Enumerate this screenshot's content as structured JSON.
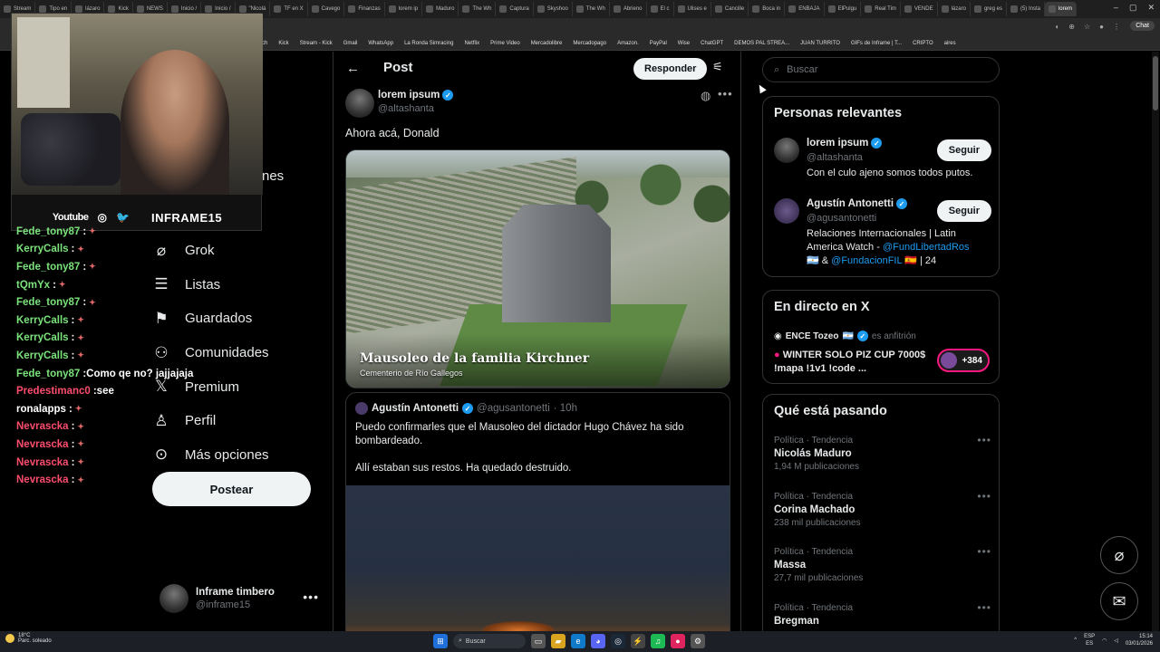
{
  "browser": {
    "tabs": [
      "Stream",
      "Tipo en",
      "lázaro",
      "Kick",
      "NEWS",
      "Inicio /",
      "Inicio /",
      "\"Nicolá",
      "TF en X",
      "Cavego",
      "Finanzas",
      "lorem ip",
      "Maduro",
      "The Wh",
      "Captura",
      "Skyshoo",
      "The Wh",
      "Abrieno",
      "El c",
      "Ulises e",
      "Cancille",
      "Boca in",
      "ENBAJA",
      "ElPulgu",
      "Real Tim",
      "VENDE",
      "lázaro",
      "greg es",
      "(5) Insta",
      "lorem"
    ],
    "bookmarks": [
      "itch",
      "Kick",
      "Stream - Kick",
      "Gmail",
      "WhatsApp",
      "La Ronda Simracing",
      "Netflix",
      "Prime Video",
      "Mercadolibre",
      "Mercadopago",
      "Amazon.",
      "PayPal",
      "Wise",
      "ChatGPT",
      "DEMOS PAL STREA...",
      "JUAN TURRITO",
      "GIFs de Inframe | T...",
      "CRIPTO",
      "aires"
    ],
    "chat_label": "Chat"
  },
  "webcam": {
    "youtube": "Youtube",
    "brand": "INFRAME15"
  },
  "chat": [
    {
      "user": "Fede_tony87",
      "color": "#7be37b",
      "msg": ""
    },
    {
      "user": "KerryCalls",
      "color": "#7be37b",
      "msg": ""
    },
    {
      "user": "Fede_tony87",
      "color": "#7be37b",
      "msg": ""
    },
    {
      "user": "tQmYx",
      "color": "#7be37b",
      "msg": ""
    },
    {
      "user": "Fede_tony87",
      "color": "#7be37b",
      "msg": ""
    },
    {
      "user": "KerryCalls",
      "color": "#7be37b",
      "msg": ""
    },
    {
      "user": "KerryCalls",
      "color": "#7be37b",
      "msg": ""
    },
    {
      "user": "KerryCalls",
      "color": "#7be37b",
      "msg": ""
    },
    {
      "user": "Fede_tony87",
      "color": "#7be37b",
      "msg": "Como qe no? jajjajaja"
    },
    {
      "user": "Predestimanc0",
      "color": "#ff4d6d",
      "msg": "see"
    },
    {
      "user": "ronalapps",
      "color": "#ffffff",
      "msg": ""
    },
    {
      "user": "Nevrascka",
      "color": "#ff4d6d",
      "msg": ""
    },
    {
      "user": "Nevrascka",
      "color": "#ff4d6d",
      "msg": ""
    },
    {
      "user": "Nevrascka",
      "color": "#ff4d6d",
      "msg": ""
    },
    {
      "user": "Nevrascka",
      "color": "#ff4d6d",
      "msg": ""
    }
  ],
  "nav": {
    "partial_label": "nes",
    "items": [
      {
        "icon": "grok-icon",
        "label": "Grok"
      },
      {
        "icon": "lists-icon",
        "label": "Listas"
      },
      {
        "icon": "bookmark-icon",
        "label": "Guardados"
      },
      {
        "icon": "communities-icon",
        "label": "Comunidades"
      },
      {
        "icon": "x-logo-icon",
        "label": "Premium"
      },
      {
        "icon": "profile-icon",
        "label": "Perfil"
      },
      {
        "icon": "more-options-icon",
        "label": "Más opciones"
      }
    ],
    "post_button": "Postear",
    "account": {
      "name": "Inframe timbero",
      "handle": "@inframe15"
    }
  },
  "post": {
    "header_title": "Post",
    "reply_button": "Responder",
    "author_name": "lorem ipsum",
    "author_handle": "@altashanta",
    "text": "Ahora acá, Donald",
    "media_caption_title": "Mausoleo de la familia Kirchner",
    "media_caption_sub": "Cementerio de Río Gallegos",
    "quote": {
      "name": "Agustín Antonetti",
      "handle": "@agusantonetti",
      "time": "· 10h",
      "line1": "Puedo confirmarles que el Mausoleo del dictador Hugo Chávez ha sido bombardeado.",
      "line2": "Allí estaban sus restos. Ha quedado destruido."
    }
  },
  "right": {
    "search_placeholder": "Buscar",
    "relevant": {
      "title": "Personas relevantes",
      "people": [
        {
          "name": "lorem ipsum",
          "handle": "@altashanta",
          "bio": "Con el culo ajeno somos todos putos.",
          "follow": "Seguir"
        },
        {
          "name": "Agustín Antonetti",
          "handle": "@agusantonetti",
          "bio_prefix": "Relaciones Internacionales | Latin America Watch - ",
          "bio_link1": "@FundLibertadRos",
          "bio_mid": " & ",
          "bio_link2": "@FundacionFIL",
          "bio_suffix": " | 24",
          "follow": "Seguir"
        }
      ]
    },
    "live": {
      "title": "En directo en X",
      "host": "ENCE Tozeo",
      "host_tag": "es anfitrión",
      "stream_title": "WINTER SOLO PIZ CUP 7000$ !mapa !1v1 !code ...",
      "listeners": "+384"
    },
    "trends": {
      "title": "Qué está pasando",
      "items": [
        {
          "meta": "Política · Tendencia",
          "name": "Nicolás Maduro",
          "count": "1,94 M publicaciones"
        },
        {
          "meta": "Política · Tendencia",
          "name": "Corina Machado",
          "count": "238 mil publicaciones"
        },
        {
          "meta": "Política · Tendencia",
          "name": "Massa",
          "count": "27,7 mil publicaciones"
        },
        {
          "meta": "Política · Tendencia",
          "name": "Bregman",
          "count": ""
        }
      ]
    }
  },
  "taskbar": {
    "weather_temp": "18°C",
    "weather_desc": "Parc. soleado",
    "search": "Buscar",
    "lang": "ESP",
    "region": "ES",
    "time": "15:14",
    "date": "03/01/2026"
  }
}
